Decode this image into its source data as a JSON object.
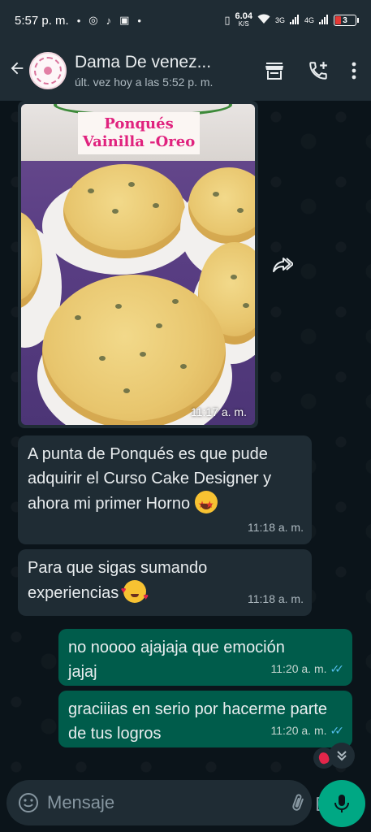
{
  "status_bar": {
    "time": "5:57 p. m.",
    "net_speed": "6.04",
    "net_unit": "K/S",
    "signal1": "3G",
    "signal2": "4G",
    "battery": "3"
  },
  "header": {
    "contact_name": "Dama De venez...",
    "last_seen": "últ. vez hoy a las 5:52 p. m."
  },
  "messages": [
    {
      "type": "image",
      "direction": "in",
      "caption_overlay": "Ponqués Vainilla -Oreo",
      "overlay_line1": "Ponqués",
      "overlay_line2": "Vainilla -Oreo",
      "time": "11:17 a. m."
    },
    {
      "type": "text",
      "direction": "in",
      "text": "A punta de Ponqués es que pude adquirir el Curso Cake Designer y ahora mi primer Horno",
      "emoji": "star-struck-emoji",
      "time": "11:18 a. m."
    },
    {
      "type": "text",
      "direction": "in",
      "text": "Para que sigas sumando experiencias",
      "emoji": "smiling-face-with-hearts-emoji",
      "time": "11:18 a. m."
    },
    {
      "type": "text",
      "direction": "out",
      "text": "no noooo ajajaja que emoción jajaj",
      "time": "11:20 a. m.",
      "status": "read"
    },
    {
      "type": "text",
      "direction": "out",
      "text": "graciiias en serio por hacerme parte de tus logros",
      "time": "11:20 a. m.",
      "status": "read"
    }
  ],
  "composer": {
    "placeholder": "Mensaje"
  },
  "colors": {
    "background": "#0b141a",
    "bar": "#1f2c34",
    "incoming": "#1f2c34",
    "outgoing": "#005c4b",
    "accent": "#00a884",
    "read_ticks": "#53bdeb"
  }
}
